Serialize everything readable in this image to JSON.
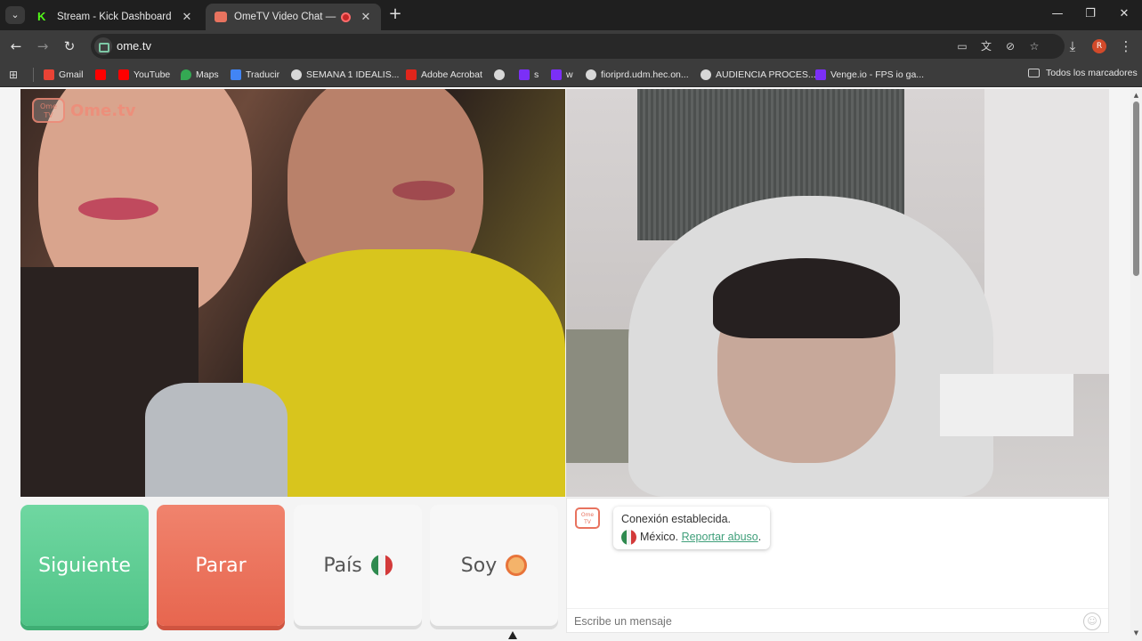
{
  "browser": {
    "tabs": [
      {
        "title": "Stream - Kick Dashboard",
        "icon": "kick-icon"
      },
      {
        "title": "OmeTV Video Chat — Ome",
        "icon": "ometv-icon"
      }
    ],
    "url": "ome.tv",
    "profile_initial": "R",
    "bookmarks": [
      {
        "label": "Gmail",
        "icon": "gmail-icon"
      },
      {
        "label": "",
        "icon": "youtube-icon"
      },
      {
        "label": "YouTube",
        "icon": "youtube-icon"
      },
      {
        "label": "Maps",
        "icon": "maps-icon"
      },
      {
        "label": "Traducir",
        "icon": "translate-icon"
      },
      {
        "label": "SEMANA 1 IDEALIS...",
        "icon": "globe-icon"
      },
      {
        "label": "Adobe Acrobat",
        "icon": "acrobat-icon"
      },
      {
        "label": "",
        "icon": "globe-icon"
      },
      {
        "label": "s",
        "icon": "v-icon"
      },
      {
        "label": "w",
        "icon": "v-icon"
      },
      {
        "label": "fioriprd.udm.hec.on...",
        "icon": "globe-icon"
      },
      {
        "label": "AUDIENCIA PROCES...",
        "icon": "globe-icon"
      },
      {
        "label": "Venge.io - FPS io ga...",
        "icon": "v-icon"
      }
    ],
    "all_bookmarks": "Todos los marcadores"
  },
  "site": {
    "logo_text": "Ome.tv",
    "logo_badge": "Ome\nTV"
  },
  "controls": {
    "next": "Siguiente",
    "stop": "Parar",
    "country": "País",
    "gender": "Soy"
  },
  "chat": {
    "status": "Conexión establecida.",
    "country": "México.",
    "report": "Reportar abuso",
    "report_suffix": ".",
    "placeholder": "Escribe un mensaje"
  },
  "colors": {
    "next": "#5ccc92",
    "stop": "#ec7059",
    "link": "#3f9f7a"
  }
}
